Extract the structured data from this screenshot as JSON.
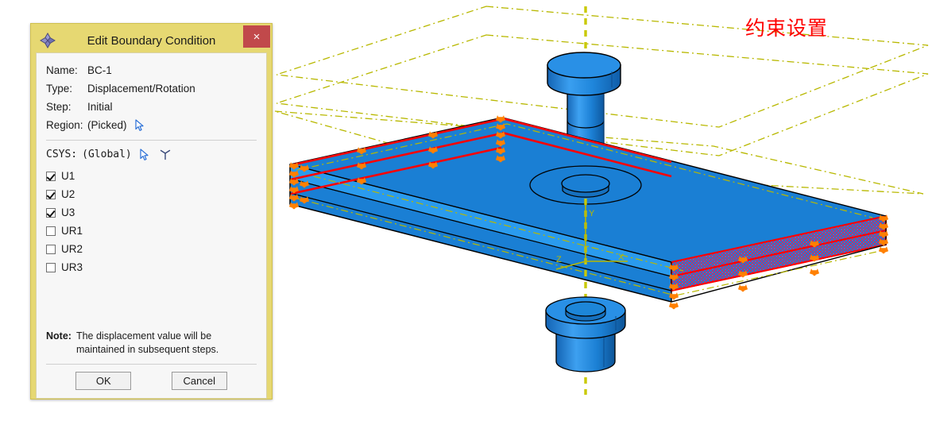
{
  "annotation": {
    "text": "约束设置",
    "color": "#fe0000"
  },
  "dialog": {
    "title": "Edit Boundary Condition",
    "icon": "diamond-spinner-icon",
    "close_label": "×",
    "fields": [
      {
        "label": "Name:",
        "value": "BC-1",
        "mono": false,
        "picker": false
      },
      {
        "label": "Type:",
        "value": "Displacement/Rotation",
        "mono": false,
        "picker": false
      },
      {
        "label": "Step:",
        "value": "Initial",
        "mono": false,
        "picker": false
      },
      {
        "label": "Region:",
        "value": "(Picked)",
        "mono": false,
        "picker": true
      }
    ],
    "csys": {
      "label": "CSYS:",
      "value": "(Global)",
      "picker_icon": "cursor-arrow-icon",
      "triad_icon": "datum-csys-icon"
    },
    "dof": [
      {
        "label": "U1",
        "checked": true
      },
      {
        "label": "U2",
        "checked": true
      },
      {
        "label": "U3",
        "checked": true
      },
      {
        "label": "UR1",
        "checked": false
      },
      {
        "label": "UR2",
        "checked": false
      },
      {
        "label": "UR3",
        "checked": false
      }
    ],
    "note": {
      "prefix": "Note:",
      "text": "The displacement value will be maintained in subsequent steps."
    },
    "buttons": {
      "ok": "OK",
      "cancel": "Cancel"
    },
    "colors": {
      "frame": "#e6d872",
      "body": "#f7f7f7",
      "close": "#c1494b"
    }
  },
  "viewport": {
    "background": "#ffffff",
    "triad": {
      "x_label": "X",
      "y_label": "Y",
      "z_label": "Z",
      "color": "#b8b800"
    },
    "model": {
      "part_color": "#1a7fd4",
      "part_color_light": "#2a9bee",
      "highlight_edge_color": "#ff0000",
      "bc_symbol_color": "#ff8000",
      "datum_color": "#b8b800",
      "selected_face_color": "#b03a6a",
      "sheet_count": 3,
      "components": [
        "punch-head",
        "punch-shaft",
        "sheet-stack",
        "die",
        "datum-planes",
        "axis-line"
      ]
    }
  }
}
